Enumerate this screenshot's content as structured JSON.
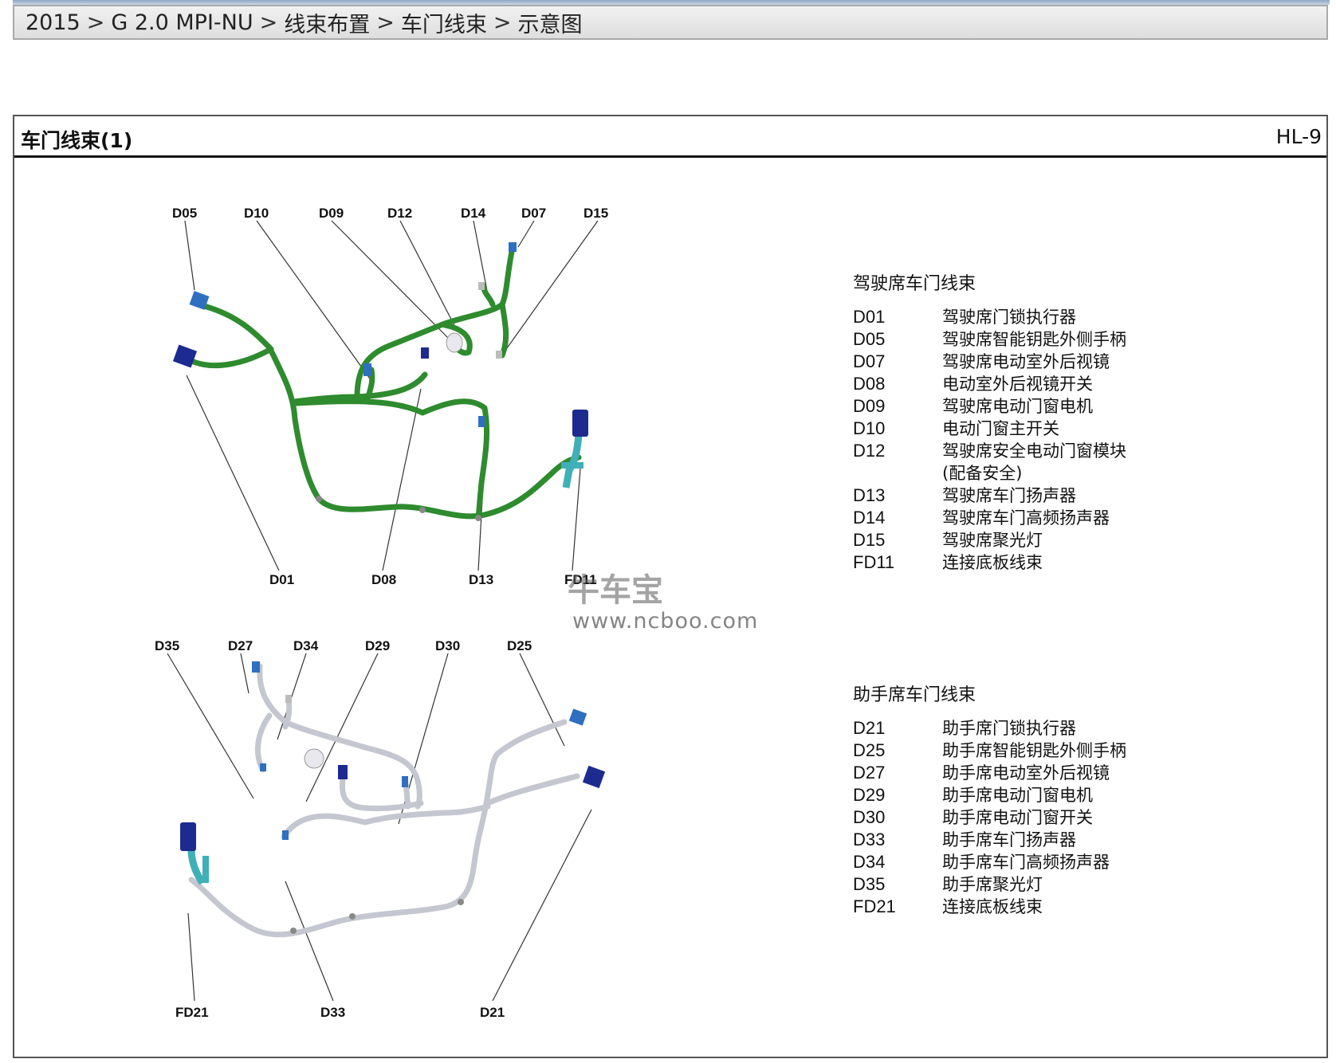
{
  "breadcrumb": {
    "items": [
      "2015",
      "G 2.0 MPI-NU",
      "线束布置",
      "车门线束",
      "示意图"
    ],
    "separator": ">"
  },
  "panel": {
    "title": "车门线束(1)",
    "code": "HL-9"
  },
  "driver_diagram": {
    "callouts": [
      "D05",
      "D10",
      "D09",
      "D12",
      "D14",
      "D07",
      "D15",
      "D01",
      "D08",
      "D13",
      "FD11"
    ],
    "harness_color": "#2e8b2e"
  },
  "passenger_diagram": {
    "callouts": [
      "D35",
      "D27",
      "D34",
      "D29",
      "D30",
      "D25",
      "FD21",
      "D33",
      "D21"
    ],
    "harness_color": "#c4c6d0"
  },
  "legend_driver": {
    "heading": "驾驶席车门线束",
    "items": [
      {
        "code": "D01",
        "desc": "驾驶席门锁执行器"
      },
      {
        "code": "D05",
        "desc": "驾驶席智能钥匙外侧手柄"
      },
      {
        "code": "D07",
        "desc": "驾驶席电动室外后视镜"
      },
      {
        "code": "D08",
        "desc": "电动室外后视镜开关"
      },
      {
        "code": "D09",
        "desc": "驾驶席电动门窗电机"
      },
      {
        "code": "D10",
        "desc": "电动门窗主开关"
      },
      {
        "code": "D12",
        "desc": "驾驶席安全电动门窗模块\n(配备安全)"
      },
      {
        "code": "D13",
        "desc": "驾驶席车门扬声器"
      },
      {
        "code": "D14",
        "desc": "驾驶席车门高频扬声器"
      },
      {
        "code": "D15",
        "desc": "驾驶席聚光灯"
      },
      {
        "code": "FD11",
        "desc": "连接底板线束"
      }
    ]
  },
  "legend_passenger": {
    "heading": "助手席车门线束",
    "items": [
      {
        "code": "D21",
        "desc": "助手席门锁执行器"
      },
      {
        "code": "D25",
        "desc": "助手席智能钥匙外侧手柄"
      },
      {
        "code": "D27",
        "desc": "助手席电动室外后视镜"
      },
      {
        "code": "D29",
        "desc": "助手席电动门窗电机"
      },
      {
        "code": "D30",
        "desc": "助手席电动门窗开关"
      },
      {
        "code": "D33",
        "desc": "助手席车门扬声器"
      },
      {
        "code": "D34",
        "desc": "助手席车门高频扬声器"
      },
      {
        "code": "D35",
        "desc": "助手席聚光灯"
      },
      {
        "code": "FD21",
        "desc": "连接底板线束"
      }
    ]
  },
  "watermark": {
    "text": "牛车宝",
    "url": "www.ncboo.com"
  },
  "colors": {
    "connector": "#1d2a8f",
    "connector_blue": "#2f6fc0",
    "connector_teal": "#3fb0b8"
  }
}
